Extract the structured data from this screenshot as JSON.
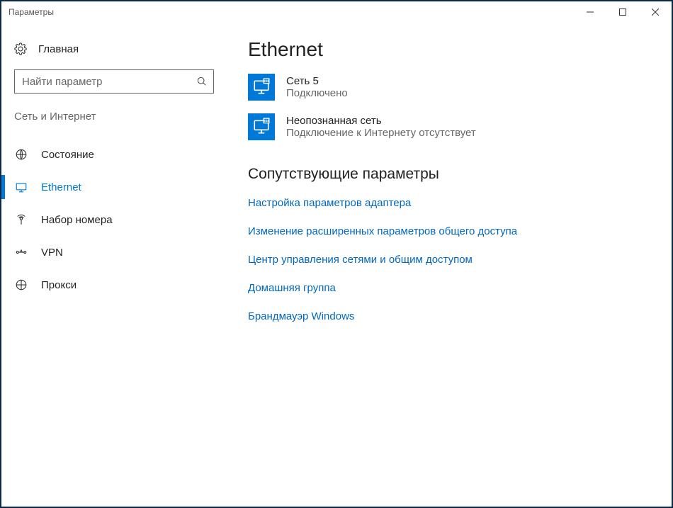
{
  "window": {
    "title": "Параметры"
  },
  "sidebar": {
    "home": "Главная",
    "search_placeholder": "Найти параметр",
    "category": "Сеть и Интернет",
    "items": [
      {
        "id": "status",
        "label": "Состояние"
      },
      {
        "id": "ethernet",
        "label": "Ethernet"
      },
      {
        "id": "dialup",
        "label": "Набор номера"
      },
      {
        "id": "vpn",
        "label": "VPN"
      },
      {
        "id": "proxy",
        "label": "Прокси"
      }
    ],
    "active": "ethernet"
  },
  "main": {
    "title": "Ethernet",
    "networks": [
      {
        "name": "Сеть  5",
        "status": "Подключено"
      },
      {
        "name": "Неопознанная сеть",
        "status": "Подключение к Интернету отсутствует"
      }
    ],
    "related_title": "Сопутствующие параметры",
    "links": [
      "Настройка параметров адаптера",
      "Изменение расширенных параметров общего доступа",
      "Центр управления сетями и общим доступом",
      "Домашняя группа",
      "Брандмауэр Windows"
    ]
  }
}
